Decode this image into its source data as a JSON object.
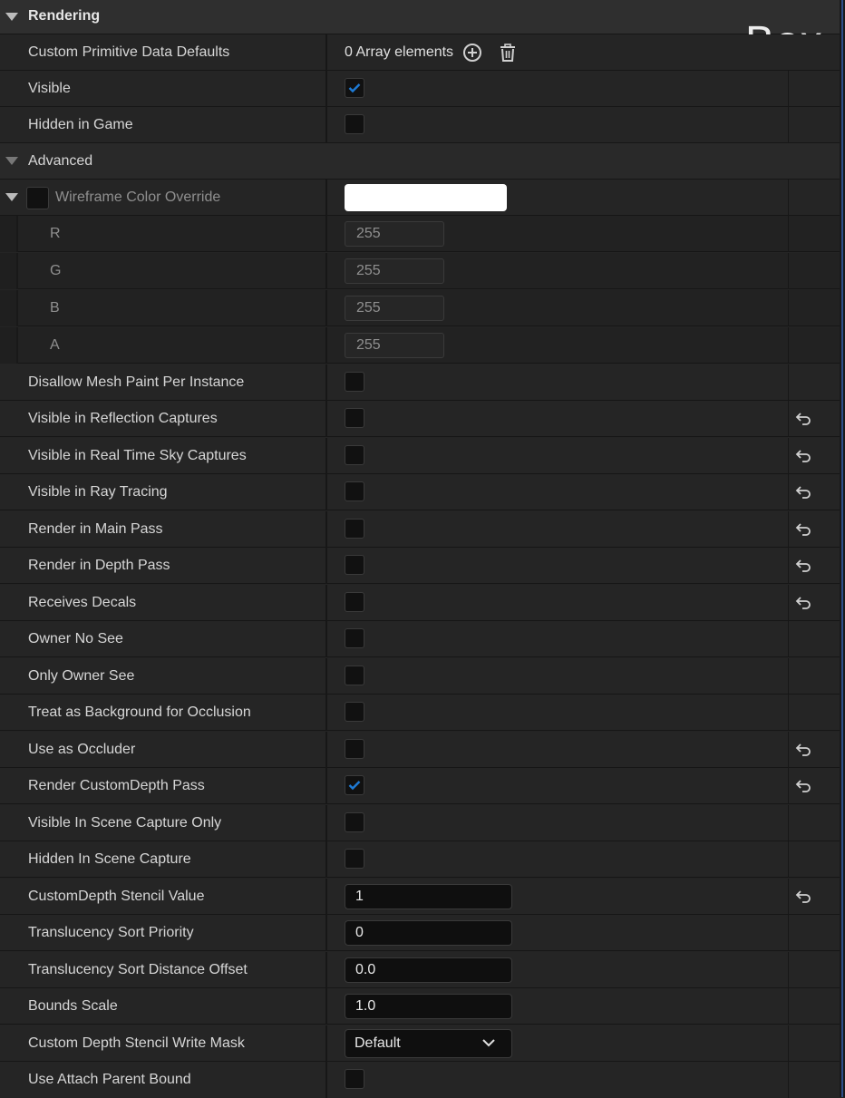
{
  "overlay_title": "Box",
  "rendering": {
    "section_label": "Rendering",
    "custom_primitive": {
      "label": "Custom Primitive Data Defaults",
      "value": "0 Array elements"
    },
    "visible": {
      "label": "Visible",
      "checked": true
    },
    "hidden_in_game": {
      "label": "Hidden in Game",
      "checked": false
    },
    "advanced": {
      "section_label": "Advanced",
      "wireframe": {
        "label": "Wireframe Color Override",
        "enabled": false,
        "color": "#ffffff",
        "channels": [
          {
            "label": "R",
            "value": "255"
          },
          {
            "label": "G",
            "value": "255"
          },
          {
            "label": "B",
            "value": "255"
          },
          {
            "label": "A",
            "value": "255"
          }
        ]
      },
      "disallow_mesh_paint": {
        "label": "Disallow Mesh Paint Per Instance",
        "checked": false
      },
      "visible_reflection_captures": {
        "label": "Visible in Reflection Captures",
        "checked": false,
        "reset_available": true
      },
      "visible_realtime_sky": {
        "label": "Visible in Real Time Sky Captures",
        "checked": false,
        "reset_available": true
      },
      "visible_ray_tracing": {
        "label": "Visible in Ray Tracing",
        "checked": false,
        "reset_available": true
      },
      "render_main_pass": {
        "label": "Render in Main Pass",
        "checked": false,
        "reset_available": true
      },
      "render_depth_pass": {
        "label": "Render in Depth Pass",
        "checked": false,
        "reset_available": true
      },
      "receives_decals": {
        "label": "Receives Decals",
        "checked": false,
        "reset_available": true
      },
      "owner_no_see": {
        "label": "Owner No See",
        "checked": false
      },
      "only_owner_see": {
        "label": "Only Owner See",
        "checked": false
      },
      "treat_background_occlusion": {
        "label": "Treat as Background for Occlusion",
        "checked": false
      },
      "use_as_occluder": {
        "label": "Use as Occluder",
        "checked": false,
        "reset_available": true
      },
      "render_customdepth": {
        "label": "Render CustomDepth Pass",
        "checked": true,
        "reset_available": true
      },
      "visible_scene_capture_only": {
        "label": "Visible In Scene Capture Only",
        "checked": false
      },
      "hidden_scene_capture": {
        "label": "Hidden In Scene Capture",
        "checked": false
      },
      "customdepth_stencil_value": {
        "label": "CustomDepth Stencil Value",
        "value": "1",
        "reset_available": true
      },
      "translucency_sort_priority": {
        "label": "Translucency Sort Priority",
        "value": "0"
      },
      "translucency_sort_distance": {
        "label": "Translucency Sort Distance Offset",
        "value": "0.0"
      },
      "bounds_scale": {
        "label": "Bounds Scale",
        "value": "1.0"
      },
      "stencil_write_mask": {
        "label": "Custom Depth Stencil Write Mask",
        "value": "Default"
      },
      "use_attach_parent_bound": {
        "label": "Use Attach Parent Bound",
        "checked": false
      }
    }
  },
  "colors": {
    "checkmark": "#1e7bd6",
    "accent_edge": "#2c4f8a"
  }
}
